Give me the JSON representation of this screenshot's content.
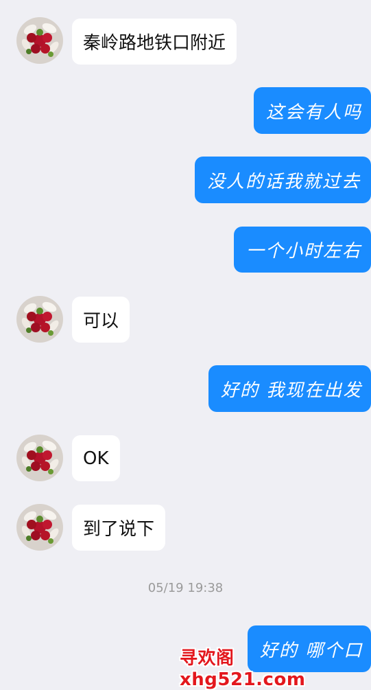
{
  "messages": [
    {
      "side": "in",
      "text": "秦岭路地铁口附近"
    },
    {
      "side": "out",
      "text": "这会有人吗"
    },
    {
      "side": "out",
      "text": "没人的话我就过去"
    },
    {
      "side": "out",
      "text": "一个小时左右"
    },
    {
      "side": "in",
      "text": "可以"
    },
    {
      "side": "out",
      "text": "好的 我现在出发"
    },
    {
      "side": "in",
      "text": "OK"
    },
    {
      "side": "in",
      "text": "到了说下"
    },
    {
      "side": "out",
      "text": "好的 哪个口"
    }
  ],
  "timestamp": "05/19 19:38",
  "watermark": "寻欢阁xhg521.com",
  "colors": {
    "background": "#efeff4",
    "incoming_bubble": "#ffffff",
    "outgoing_bubble": "#1a8cff",
    "watermark": "#e3171d"
  },
  "avatar_icon": "flower-bouquet-icon"
}
